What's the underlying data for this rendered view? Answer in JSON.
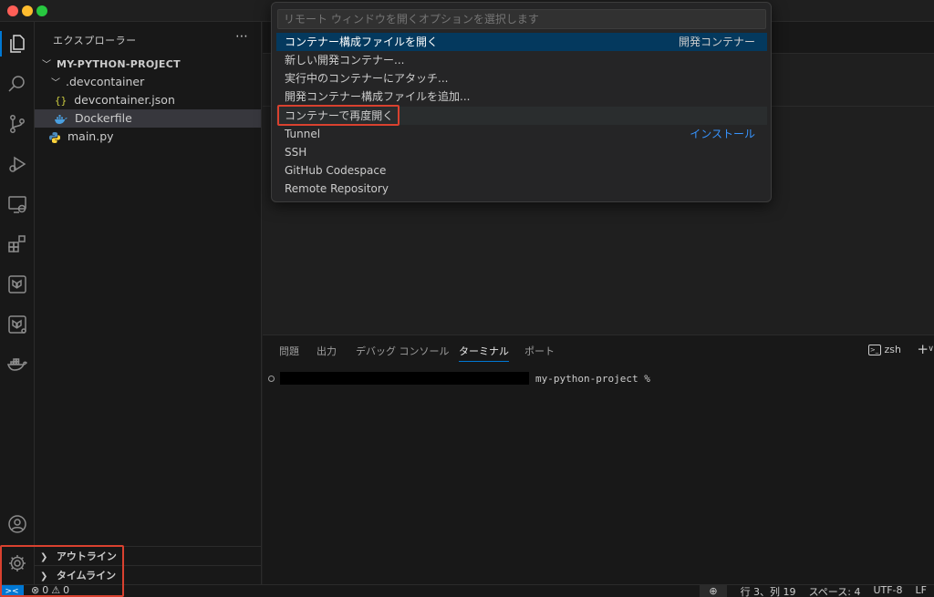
{
  "sidebar": {
    "header": "エクスプローラー",
    "more": "⋯",
    "project": "MY-PYTHON-PROJECT",
    "tree": [
      {
        "label": ".devcontainer"
      },
      {
        "label": "devcontainer.json",
        "icon": "{}"
      },
      {
        "label": "Dockerfile"
      },
      {
        "label": "main.py"
      }
    ],
    "outline": "アウトライン",
    "timeline": "タイムライン"
  },
  "quickpick": {
    "placeholder": "リモート ウィンドウを開くオプションを選択します",
    "items": [
      {
        "label": "コンテナー構成ファイルを開く",
        "detail": "開発コンテナー"
      },
      {
        "label": "新しい開発コンテナー..."
      },
      {
        "label": "実行中のコンテナーにアタッチ..."
      },
      {
        "label": "開発コンテナー構成ファイルを追加..."
      },
      {
        "label": "コンテナーで再度開く"
      },
      {
        "label": "Tunnel",
        "link": "インストール"
      },
      {
        "label": "SSH"
      },
      {
        "label": "GitHub Codespace"
      },
      {
        "label": "Remote Repository"
      }
    ]
  },
  "panel": {
    "tabs": [
      "問題",
      "出力",
      "デバッグ コンソール",
      "ターミナル",
      "ポート"
    ],
    "shell": "zsh",
    "shell_icon": ">_",
    "add": "+",
    "chevron": "∨",
    "prompt": "my-python-project %"
  },
  "statusbar": {
    "remote": "><",
    "errors": "0",
    "warnings": "0",
    "zoom": "⊕",
    "position": "行 3、列 19",
    "spaces": "スペース: 4",
    "encoding": "UTF-8",
    "eol": "LF"
  }
}
